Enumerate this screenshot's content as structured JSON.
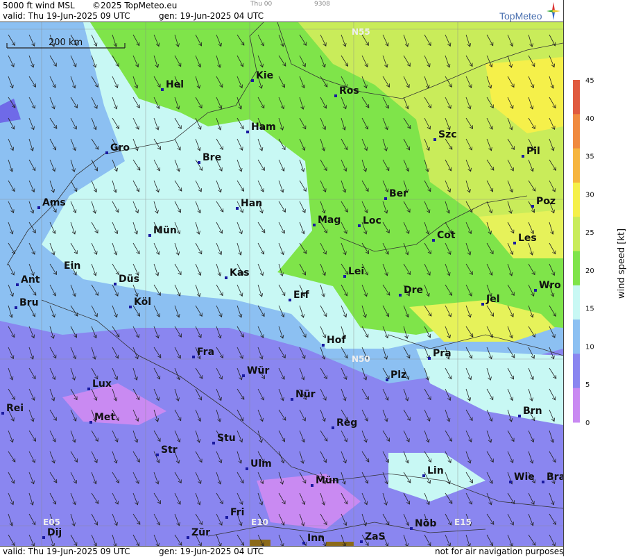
{
  "header": {
    "product": "5000 ft wind MSL",
    "copyright": "©2025 TopMeteo.eu",
    "valid": "valid:  Thu  19-Jun-2025  09 UTC",
    "generated": "gen: 19-Jun-2025 04 UTC",
    "small_a": "Thu 00",
    "small_b": "9308",
    "logo": "TopMeteo"
  },
  "footer": {
    "valid": "valid:  Thu  19-Jun-2025  09 UTC",
    "generated": "gen: 19-Jun-2025 04 UTC",
    "disclaimer": "not for air navigation purposes"
  },
  "map": {
    "scale_bar": "200 km",
    "grid_labels": [
      "N55",
      "N50",
      "E05",
      "E10",
      "E15"
    ],
    "cities": [
      "Hel",
      "Kie",
      "Ros",
      "Ham",
      "Szc",
      "Gro",
      "Bre",
      "Pil",
      "Ams",
      "Han",
      "Ber",
      "Poz",
      "Mag",
      "Loc",
      "Mün",
      "Cot",
      "Les",
      "Ein",
      "Ant",
      "Kas",
      "Lei",
      "Düs",
      "Wro",
      "Bru",
      "Köl",
      "Erf",
      "Dre",
      "Jel",
      "Hof",
      "Fra",
      "Pra",
      "Würz",
      "Plz",
      "Lux",
      "Nür",
      "Rei",
      "Met",
      "Brn",
      "Reg",
      "Stu",
      "Str",
      "Lin",
      "Ulm",
      "Wie",
      "Bra",
      "Mün2",
      "Fri",
      "Nöb",
      "Dij",
      "Zür",
      "Inn",
      "ZaS"
    ],
    "city_labels": {
      "Hel": "Hel",
      "Kie": "Kie",
      "Ros": "Ros",
      "Ham": "Ham",
      "Szc": "Szc",
      "Gro": "Gro",
      "Bre": "Bre",
      "Pil": "Pil",
      "Ams": "Ams",
      "Han": "Han",
      "Ber": "Ber",
      "Poz": "Poz",
      "Mag": "Mag",
      "Loc": "Loc",
      "Mün": "Mün",
      "Cot": "Cot",
      "Les": "Les",
      "Ein": "Ein",
      "Ant": "Ant",
      "Kas": "Kas",
      "Lei": "Lei",
      "Düs": "Düs",
      "Wro": "Wro",
      "Bru": "Bru",
      "Köl": "Köl",
      "Erf": "Erf",
      "Dre": "Dre",
      "Jel": "Jel",
      "Hof": "Hof",
      "Fra": "Fra",
      "Pra": "Pra",
      "Würz": "Wür",
      "Plz": "Plz",
      "Lux": "Lux",
      "Nür": "Nür",
      "Rei": "Rei",
      "Met": "Met",
      "Brn": "Brn",
      "Reg": "Reg",
      "Stu": "Stu",
      "Str": "Str",
      "Lin": "Lin",
      "Ulm": "Ulm",
      "Wie": "Wie",
      "Bra": "Bra",
      "Mün2": "Mün",
      "Fri": "Fri",
      "Nöb": "Nöb",
      "Dij": "Dij",
      "Zür": "Zür",
      "Inn": "Inn",
      "ZaS": "ZaS"
    }
  },
  "legend": {
    "label": "wind speed  [kt]",
    "ticks": [
      "45",
      "40",
      "35",
      "30",
      "25",
      "20",
      "15",
      "10",
      "5",
      "0"
    ],
    "colors": [
      "#e05a3f",
      "#f08a3f",
      "#f6b53f",
      "#f5f04a",
      "#c9ec5a",
      "#7fe44a",
      "#c8f8f4",
      "#8cc0f2",
      "#8a86f0",
      "#c98af2"
    ]
  },
  "colors": {
    "green": "#7fe44a",
    "lightgreen": "#c9ec5a",
    "cyan": "#c8f8f4",
    "blue": "#8cc0f2",
    "violet": "#8a86f0",
    "purple": "#c98af2"
  }
}
